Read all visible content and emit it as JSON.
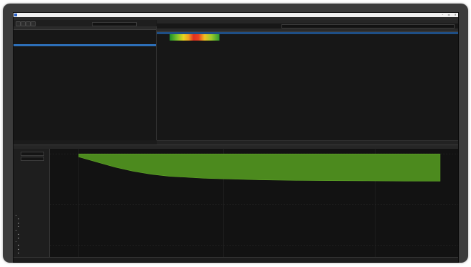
{
  "window": {
    "title": ""
  },
  "menu": {
    "items": [
      "",
      "",
      "",
      "",
      ""
    ]
  },
  "search": {
    "left_placeholder": "",
    "right_placeholder": ""
  },
  "left_table": {
    "columns": [
      "",
      "",
      "",
      "",
      "",
      "",
      "",
      "",
      ""
    ],
    "rows": [
      [
        "",
        "",
        "",
        "",
        "",
        "",
        "",
        "",
        ""
      ],
      [
        "",
        "",
        "",
        "",
        "",
        "",
        "",
        "",
        ""
      ],
      [
        "",
        "",
        "",
        "",
        "",
        "",
        "",
        "",
        ""
      ],
      [
        "",
        "",
        "",
        "",
        "",
        "",
        "",
        "",
        ""
      ],
      [
        "",
        "",
        "",
        "",
        "",
        "",
        "",
        "",
        ""
      ],
      [
        "",
        "",
        "",
        "",
        "",
        "",
        "",
        "",
        ""
      ],
      [
        "",
        "",
        "",
        "",
        "",
        "",
        "",
        "",
        ""
      ],
      [
        "",
        "",
        "",
        "",
        "",
        "",
        "",
        "",
        ""
      ],
      [
        "",
        "",
        "",
        "",
        "",
        "",
        "",
        "",
        ""
      ]
    ],
    "selected_index": 6
  },
  "right_panel": {
    "title": "",
    "columns": [
      "",
      "",
      "",
      "",
      "",
      "",
      "",
      "",
      "",
      "",
      "",
      "",
      "",
      ""
    ],
    "rows": [
      [
        "",
        "",
        "",
        "",
        "",
        "",
        "",
        "",
        "",
        "",
        "",
        "",
        "",
        ""
      ],
      [
        "",
        "",
        "",
        "",
        "",
        "",
        "",
        "",
        "",
        "",
        "",
        "",
        "",
        ""
      ],
      [
        "",
        "",
        "",
        "",
        "",
        "",
        "",
        "",
        "",
        "",
        "",
        "",
        "",
        ""
      ],
      [
        "",
        "",
        "",
        "",
        "",
        "",
        "",
        "",
        "",
        "",
        "",
        "",
        "",
        ""
      ]
    ]
  },
  "right_tabs": [
    "",
    "",
    "",
    "",
    ""
  ],
  "bottom": {
    "title": "",
    "from_label": "",
    "from_value": "",
    "to_label": "",
    "to_value": "",
    "tree": [
      {
        "label": "",
        "level": 0
      },
      {
        "label": "",
        "level": 1
      },
      {
        "label": "",
        "level": 1
      },
      {
        "label": "",
        "level": 1
      },
      {
        "label": "",
        "level": 0
      },
      {
        "label": "",
        "level": 1
      },
      {
        "label": "",
        "level": 1
      },
      {
        "label": "",
        "level": 0
      },
      {
        "label": "",
        "level": 1
      },
      {
        "label": "",
        "level": 1
      },
      {
        "label": "",
        "level": 1
      }
    ]
  },
  "chart_data": {
    "type": "area",
    "title": "",
    "xlabel": "",
    "ylabel": "",
    "x": [
      0.0,
      0.05,
      0.1,
      0.15,
      0.2,
      0.25,
      0.3,
      0.35,
      0.4,
      0.45,
      0.5,
      0.6,
      0.7,
      0.8,
      0.9,
      1.0
    ],
    "series": [
      {
        "upper": [
          100,
          100,
          100,
          100,
          100,
          100,
          100,
          100,
          100,
          100,
          100,
          100,
          100,
          100,
          100,
          100
        ],
        "lower": [
          97,
          92,
          87,
          83,
          80,
          78,
          77,
          76,
          75.5,
          75,
          74.5,
          74,
          73.7,
          73.5,
          73.3,
          73.2
        ]
      }
    ],
    "xlim": [
      -0.08,
      1.05
    ],
    "ylim": [
      0,
      105
    ],
    "x_ticks": [
      {
        "value": 0.0,
        "label": ""
      },
      {
        "value": 0.4,
        "label": ""
      },
      {
        "value": 0.82,
        "label": ""
      }
    ],
    "y_ticks": [
      {
        "value": 100,
        "label": ""
      },
      {
        "value": 50,
        "label": ""
      },
      {
        "value": 10,
        "label": ""
      }
    ],
    "fill_color": "#4c8a1e",
    "grid": true
  },
  "status_tabs": [
    "",
    "",
    ""
  ],
  "colors": {
    "selection": "#2d6fb8",
    "accent": "#4c8a1e"
  }
}
